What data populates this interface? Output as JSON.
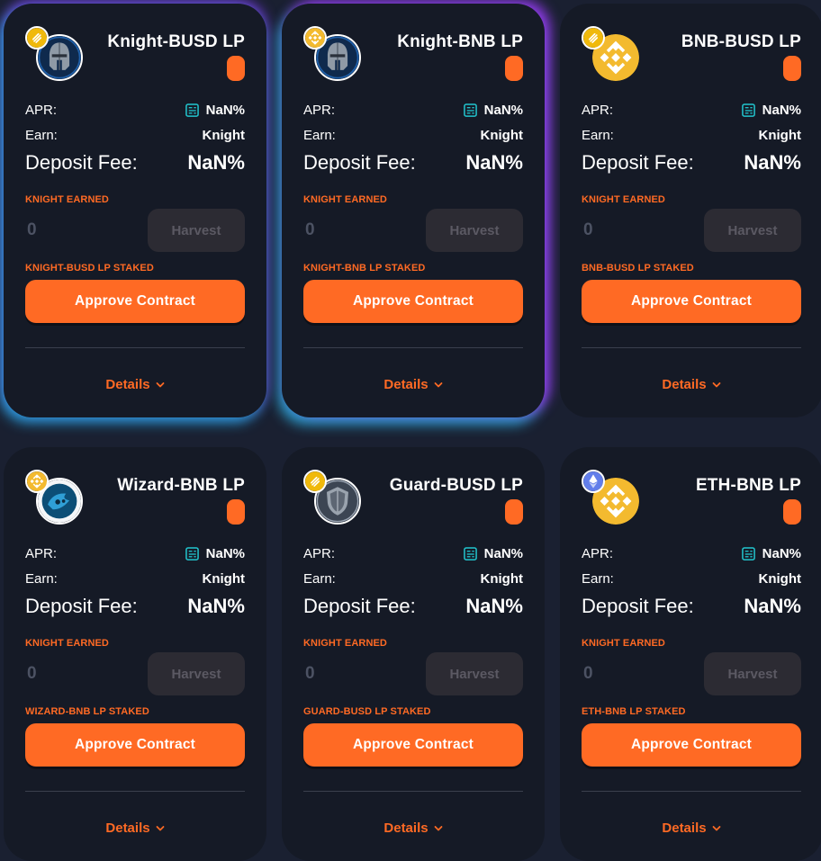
{
  "colors": {
    "accent": "#ff6a24",
    "card_bg": "#151a26",
    "page_bg": "#1a2031",
    "calc_icon": "#22c6cf"
  },
  "farms": [
    {
      "pair": "Knight-BUSD LP",
      "main_token_icon": "knight-helmet-icon",
      "badge_icon": "busd-icon",
      "apr_label": "APR:",
      "apr_value": "NaN%",
      "earn_label": "Earn:",
      "earn_value": "Knight",
      "fee_label": "Deposit Fee:",
      "fee_value": "NaN%",
      "earned_label": "KNIGHT EARNED",
      "earned_value": "0",
      "harvest_label": "Harvest",
      "staked_label": "KNIGHT-BUSD LP STAKED",
      "approve_label": "Approve Contract",
      "details_label": "Details"
    },
    {
      "pair": "Knight-BNB LP",
      "main_token_icon": "knight-helmet-icon",
      "badge_icon": "bnb-icon",
      "apr_label": "APR:",
      "apr_value": "NaN%",
      "earn_label": "Earn:",
      "earn_value": "Knight",
      "fee_label": "Deposit Fee:",
      "fee_value": "NaN%",
      "earned_label": "KNIGHT EARNED",
      "earned_value": "0",
      "harvest_label": "Harvest",
      "staked_label": "KNIGHT-BNB LP STAKED",
      "approve_label": "Approve Contract",
      "details_label": "Details"
    },
    {
      "pair": "BNB-BUSD LP",
      "main_token_icon": "bnb-icon",
      "badge_icon": "busd-icon",
      "apr_label": "APR:",
      "apr_value": "NaN%",
      "earn_label": "Earn:",
      "earn_value": "Knight",
      "fee_label": "Deposit Fee:",
      "fee_value": "NaN%",
      "earned_label": "KNIGHT EARNED",
      "earned_value": "0",
      "harvest_label": "Harvest",
      "staked_label": "BNB-BUSD LP STAKED",
      "approve_label": "Approve Contract",
      "details_label": "Details"
    },
    {
      "pair": "Wizard-BNB LP",
      "main_token_icon": "wizard-icon",
      "badge_icon": "bnb-icon",
      "apr_label": "APR:",
      "apr_value": "NaN%",
      "earn_label": "Earn:",
      "earn_value": "Knight",
      "fee_label": "Deposit Fee:",
      "fee_value": "NaN%",
      "earned_label": "KNIGHT EARNED",
      "earned_value": "0",
      "harvest_label": "Harvest",
      "staked_label": "WIZARD-BNB LP STAKED",
      "approve_label": "Approve Contract",
      "details_label": "Details"
    },
    {
      "pair": "Guard-BUSD LP",
      "main_token_icon": "guard-shield-icon",
      "badge_icon": "busd-icon",
      "apr_label": "APR:",
      "apr_value": "NaN%",
      "earn_label": "Earn:",
      "earn_value": "Knight",
      "fee_label": "Deposit Fee:",
      "fee_value": "NaN%",
      "earned_label": "KNIGHT EARNED",
      "earned_value": "0",
      "harvest_label": "Harvest",
      "staked_label": "GUARD-BUSD LP STAKED",
      "approve_label": "Approve Contract",
      "details_label": "Details"
    },
    {
      "pair": "ETH-BNB LP",
      "main_token_icon": "bnb-icon",
      "badge_icon": "eth-icon",
      "apr_label": "APR:",
      "apr_value": "NaN%",
      "earn_label": "Earn:",
      "earn_value": "Knight",
      "fee_label": "Deposit Fee:",
      "fee_value": "NaN%",
      "earned_label": "KNIGHT EARNED",
      "earned_value": "0",
      "harvest_label": "Harvest",
      "staked_label": "ETH-BNB LP STAKED",
      "approve_label": "Approve Contract",
      "details_label": "Details"
    }
  ]
}
